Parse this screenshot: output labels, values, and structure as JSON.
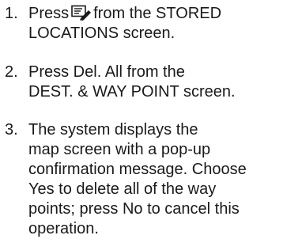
{
  "steps": [
    {
      "number": "1.",
      "before_icon": "Press",
      "icon": "edit-location-icon",
      "after_icon": "from the STORED",
      "line2": "LOCATIONS screen."
    },
    {
      "number": "2.",
      "line1": "Press Del. All from the",
      "line2": "DEST. & WAY POINT screen."
    },
    {
      "number": "3.",
      "lines": [
        "The system displays the",
        "map screen with a pop-up",
        "confirmation message. Choose",
        "Yes to delete all of the way",
        "points; press No to cancel this",
        "operation."
      ]
    }
  ]
}
